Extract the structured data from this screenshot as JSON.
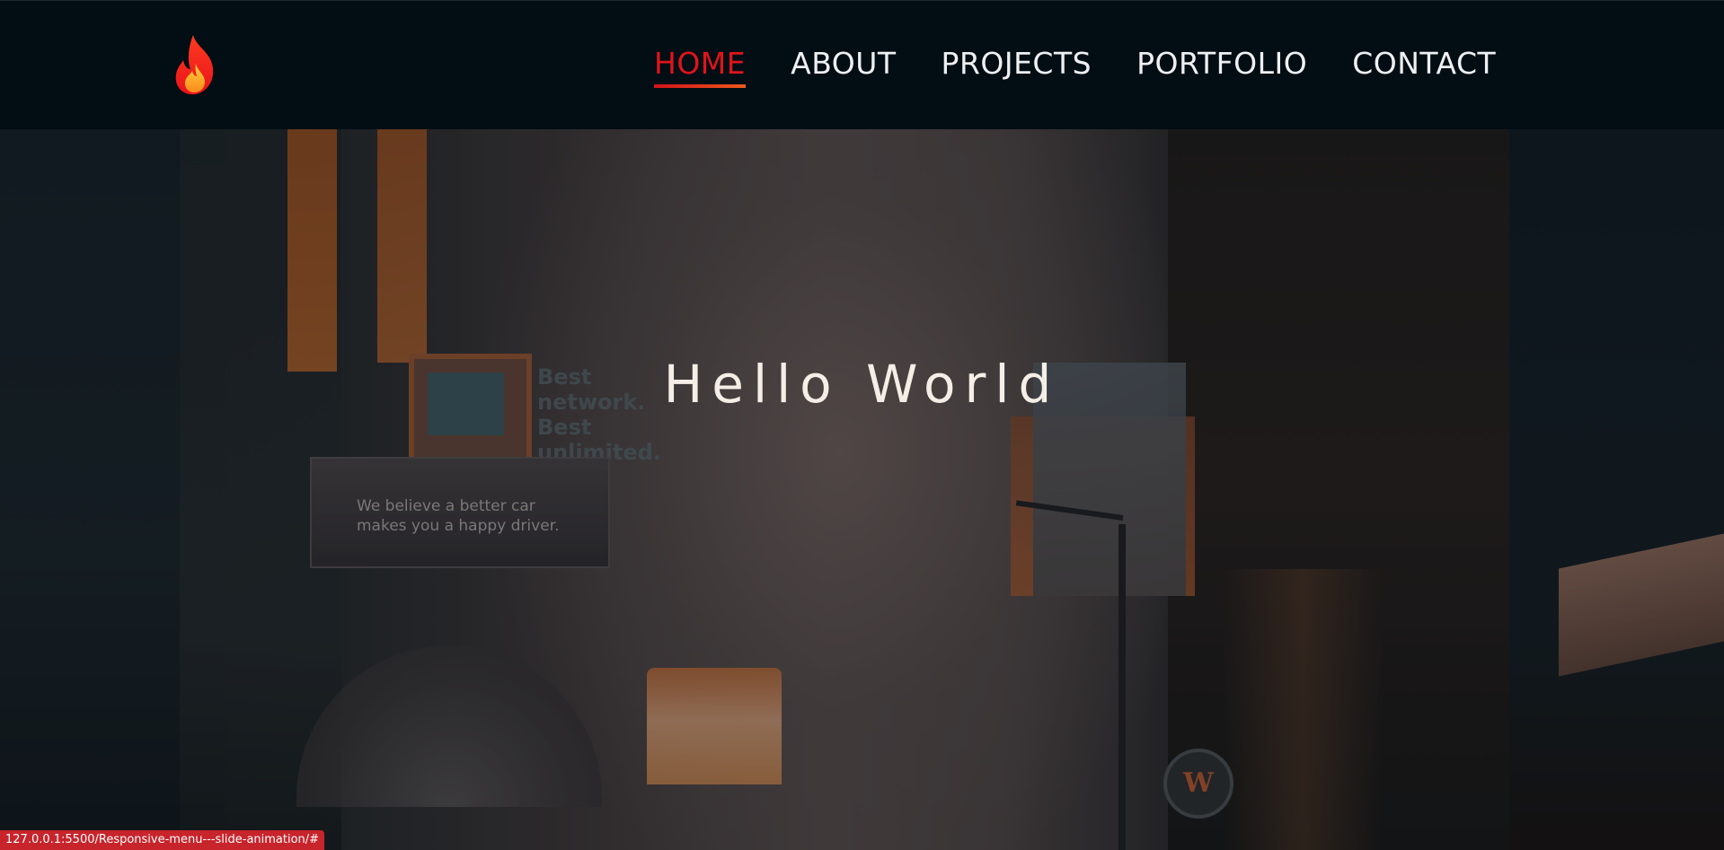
{
  "nav": {
    "logo_icon": "fire-icon",
    "items": [
      {
        "label": "HOME",
        "active": true
      },
      {
        "label": "ABOUT",
        "active": false
      },
      {
        "label": "PROJECTS",
        "active": false
      },
      {
        "label": "PORTFOLIO",
        "active": false
      },
      {
        "label": "CONTACT",
        "active": false
      }
    ]
  },
  "hero": {
    "title": "Hello World",
    "billboard_text": "We believe a better car\nmakes you a happy driver.",
    "network_sign": "Best\nnetwork.\nBest\nunlimited.",
    "store_sign_letter": "W"
  },
  "status_bar": {
    "url": "127.0.0.1:5500/Responsive-menu---slide-animation/#"
  },
  "colors": {
    "background": "#030d14",
    "nav_text": "#eef0f2",
    "active": "#e0141b",
    "underline_start": "#d3121a",
    "underline_end": "#ec5a1c",
    "hero_text": "#f5eee6",
    "status_bar": "#c8242b"
  }
}
